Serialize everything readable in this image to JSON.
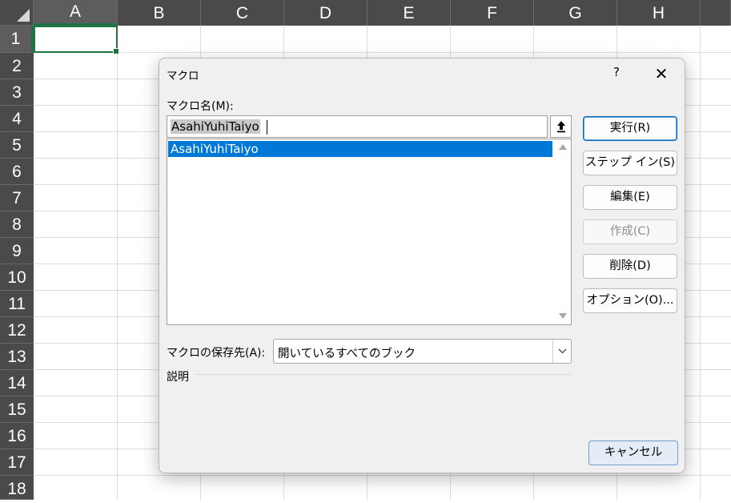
{
  "sheet": {
    "columns": [
      "A",
      "B",
      "C",
      "D",
      "E",
      "F",
      "G",
      "H"
    ],
    "rows": [
      "1",
      "2",
      "3",
      "4",
      "5",
      "6",
      "7",
      "8",
      "9",
      "10",
      "11",
      "12",
      "13",
      "14",
      "15",
      "16",
      "17",
      "18"
    ],
    "active_cell": "A1"
  },
  "dialog": {
    "title": "マクロ",
    "help_label": "?",
    "close_label": "✕",
    "name_label": "マクロ名(M):",
    "name_value": "AsahiYuhiTaiyo",
    "macros": [
      "AsahiYuhiTaiyo"
    ],
    "buttons": {
      "run": "実行(R)",
      "step_in": "ステップ イン(S)",
      "edit": "編集(E)",
      "create": "作成(C)",
      "delete": "削除(D)",
      "options": "オプション(O)...",
      "cancel": "キャンセル"
    },
    "location_label": "マクロの保存先(A):",
    "location_value": "開いているすべてのブック",
    "description_label": "説明"
  },
  "colors": {
    "accent": "#217346",
    "selection": "#0078d7",
    "header_bg": "#4a4a4a"
  }
}
